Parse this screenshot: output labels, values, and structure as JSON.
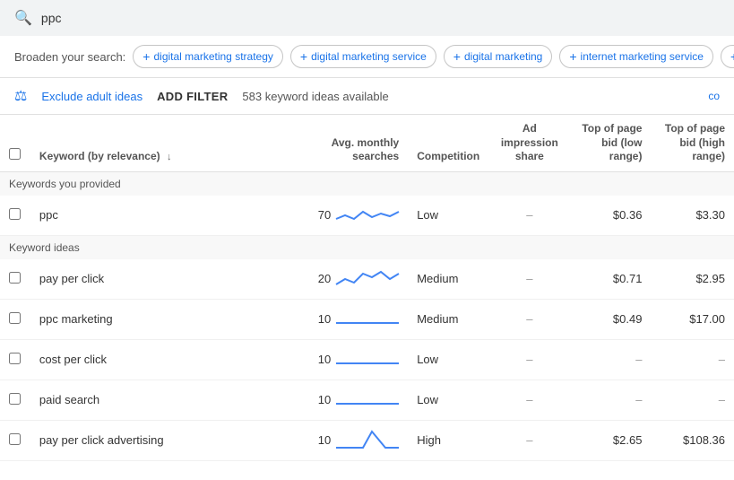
{
  "search": {
    "value": "ppc",
    "placeholder": "ppc"
  },
  "broaden": {
    "label": "Broaden your search:",
    "chips": [
      "digital marketing strategy",
      "digital marketing service",
      "digital marketing",
      "internet marketing service",
      "+ s"
    ]
  },
  "filter": {
    "exclude_label": "Exclude adult ideas",
    "add_filter": "ADD FILTER",
    "count": "583 keyword ideas available",
    "col_toggle": "co"
  },
  "table": {
    "headers": {
      "keyword": "Keyword (by relevance)",
      "monthly": "Avg. monthly searches",
      "competition": "Competition",
      "impression": "Ad impression share",
      "bid_low": "Top of page bid (low range)",
      "bid_high": "Top of page bid (high range)"
    },
    "section1": "Keywords you provided",
    "section2": "Keyword ideas",
    "rows": [
      {
        "keyword": "ppc",
        "monthly": 70,
        "competition": "Low",
        "impression": "–",
        "bid_low": "$0.36",
        "bid_high": "$3.30",
        "sparkline": "provided"
      },
      {
        "keyword": "pay per click",
        "monthly": 20,
        "competition": "Medium",
        "impression": "–",
        "bid_low": "$0.71",
        "bid_high": "$2.95",
        "sparkline": "ideas1"
      },
      {
        "keyword": "ppc marketing",
        "monthly": 10,
        "competition": "Medium",
        "impression": "–",
        "bid_low": "$0.49",
        "bid_high": "$17.00",
        "sparkline": "flat"
      },
      {
        "keyword": "cost per click",
        "monthly": 10,
        "competition": "Low",
        "impression": "–",
        "bid_low": "–",
        "bid_high": "–",
        "sparkline": "flat"
      },
      {
        "keyword": "paid search",
        "monthly": 10,
        "competition": "Low",
        "impression": "–",
        "bid_low": "–",
        "bid_high": "–",
        "sparkline": "flat"
      },
      {
        "keyword": "pay per click advertising",
        "monthly": 10,
        "competition": "High",
        "impression": "–",
        "bid_low": "$2.65",
        "bid_high": "$108.36",
        "sparkline": "spike"
      }
    ]
  }
}
